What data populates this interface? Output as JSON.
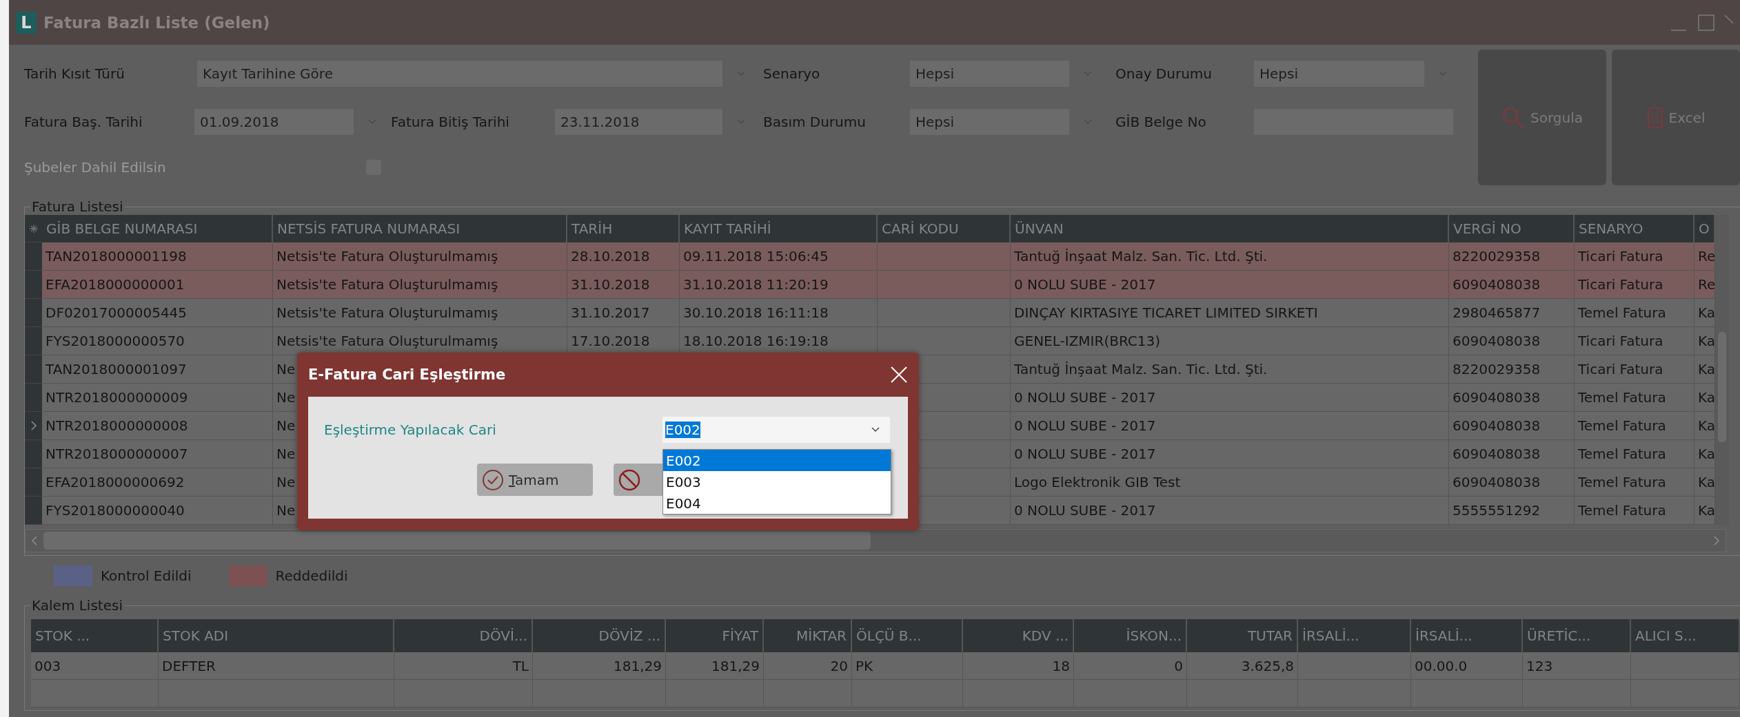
{
  "window": {
    "logo": "L",
    "title": "Fatura Bazlı Liste (Gelen)"
  },
  "filter_rows": [
    [
      {
        "kind": "label",
        "text": "Tarih Kısıt Türü",
        "disabled": false
      },
      {
        "kind": "select",
        "value": "Kayıt Tarihine Göre"
      },
      {
        "kind": "label",
        "text": "Senaryo",
        "disabled": false
      },
      {
        "kind": "select",
        "value": "Hepsi"
      },
      {
        "kind": "label",
        "text": "Onay Durumu",
        "disabled": false
      },
      {
        "kind": "select",
        "value": "Hepsi"
      }
    ],
    [
      {
        "kind": "label",
        "text": "Fatura Baş. Tarihi",
        "disabled": false
      },
      {
        "kind": "select",
        "value": "01.09.2018"
      },
      {
        "kind": "label",
        "text": "Fatura Bitiş Tarihi",
        "disabled": false
      },
      {
        "kind": "select",
        "value": "23.11.2018"
      },
      {
        "kind": "label",
        "text": "Basım Durumu",
        "disabled": false
      },
      {
        "kind": "select",
        "value": "Hepsi"
      },
      {
        "kind": "label",
        "text": "GİB Belge No",
        "disabled": false
      },
      {
        "kind": "input"
      }
    ],
    [
      {
        "kind": "label",
        "text": "Şubeler Dahil Edilsin",
        "disabled": true
      },
      {
        "kind": "checkbox",
        "checked": false
      }
    ]
  ],
  "actions": [
    {
      "kind": "search",
      "label": "Sorgula"
    },
    {
      "kind": "excel",
      "label": "Excel"
    }
  ],
  "invoices": {
    "title": "Fatura Listesi",
    "columns": [
      "GİB BELGE NUMARASI",
      "NETSİS FATURA NUMARASI",
      "TARİH",
      "KAYIT TARİHİ",
      "CARİ KODU",
      "ÜNVAN",
      "VERGİ NO",
      "SENARYO",
      "O"
    ],
    "rows": [
      {
        "rejected": true,
        "current": false,
        "cells": [
          "TAN2018000001198",
          "Netsis'te Fatura Oluşturulmamış",
          "28.10.2018",
          "09.11.2018 15:06:45",
          null,
          "Tantuğ İnşaat Malz. San. Tic. Ltd. Şti.",
          "8220029358",
          "Ticari Fatura",
          "Re"
        ]
      },
      {
        "rejected": true,
        "current": false,
        "cells": [
          "EFA2018000000001",
          "Netsis'te Fatura Oluşturulmamış",
          "31.10.2018",
          "31.10.2018 11:20:19",
          null,
          "0 NOLU SUBE - 2017",
          "6090408038",
          "Ticari Fatura",
          "Re"
        ]
      },
      {
        "rejected": false,
        "current": false,
        "cells": [
          "DF02017000005445",
          "Netsis'te Fatura Oluşturulmamış",
          "31.10.2017",
          "30.10.2018 16:11:18",
          null,
          "DINÇAY KIRTASIYE TICARET LIMITED SIRKETI",
          "2980465877",
          "Temel Fatura",
          "Ka"
        ]
      },
      {
        "rejected": false,
        "current": false,
        "cells": [
          "FYS2018000000570",
          "Netsis'te Fatura Oluşturulmamış",
          "17.10.2018",
          "18.10.2018 16:19:18",
          null,
          "GENEL-IZMIR(BRC13)",
          "6090408038",
          "Ticari Fatura",
          "Ka"
        ]
      },
      {
        "rejected": false,
        "current": false,
        "cells": [
          "TAN2018000001097",
          "Ne",
          null,
          null,
          null,
          "Tantuğ İnşaat Malz. San. Tic. Ltd. Şti.",
          "8220029358",
          "Ticari Fatura",
          "Ka"
        ]
      },
      {
        "rejected": false,
        "current": false,
        "cells": [
          "NTR2018000000009",
          "Ne",
          null,
          null,
          null,
          "0 NOLU SUBE - 2017",
          "6090408038",
          "Temel Fatura",
          "Ka"
        ]
      },
      {
        "rejected": false,
        "current": true,
        "cells": [
          "NTR2018000000008",
          "Ne",
          null,
          null,
          null,
          "0 NOLU SUBE - 2017",
          "6090408038",
          "Temel Fatura",
          "Ka"
        ]
      },
      {
        "rejected": false,
        "current": false,
        "cells": [
          "NTR2018000000007",
          "Ne",
          null,
          null,
          null,
          "0 NOLU SUBE - 2017",
          "6090408038",
          "Temel Fatura",
          "Ka"
        ]
      },
      {
        "rejected": false,
        "current": false,
        "cells": [
          "EFA2018000000692",
          "Ne",
          null,
          null,
          null,
          "Logo Elektronik GIB Test",
          "6090408038",
          "Temel Fatura",
          "Ka"
        ]
      },
      {
        "rejected": false,
        "current": false,
        "cells": [
          "FYS2018000000040",
          "Ne",
          null,
          null,
          null,
          "0 NOLU SUBE - 2017",
          "5555551292",
          "Temel Fatura",
          "Ka"
        ]
      }
    ]
  },
  "legend": [
    {
      "label": "Kontrol Edildi",
      "color": "#5b6086"
    },
    {
      "label": "Reddedildi",
      "color": "#7d5151"
    }
  ],
  "lines": {
    "title": "Kalem Listesi",
    "columns": [
      "STOK ...",
      "STOK ADI",
      "DÖVİ...",
      "DÖVİZ ...",
      "FİYAT",
      "MİKTAR",
      "ÖLÇÜ B...",
      "KDV ...",
      "İSKON...",
      "TUTAR",
      "İRSALİ...",
      "İRSALİ...",
      "ÜRETİC...",
      "ALICI S..."
    ],
    "rows": [
      [
        "003",
        "DEFTER",
        "TL",
        "181,29",
        "181,29",
        "20",
        "PK",
        "18",
        "0",
        "3.625,8",
        null,
        "00.00.0",
        "123",
        null
      ]
    ]
  },
  "dialog": {
    "title": "E-Fatura Cari Eşleştirme",
    "field_label": "Eşleştirme Yapılacak Cari",
    "value": "E002",
    "options": [
      {
        "label": "E002",
        "selected": true
      },
      {
        "label": "E003",
        "selected": false
      },
      {
        "label": "E004",
        "selected": false
      }
    ],
    "buttons": [
      {
        "kind": "ok",
        "label": "Tamam"
      },
      {
        "kind": "cancel"
      }
    ]
  }
}
